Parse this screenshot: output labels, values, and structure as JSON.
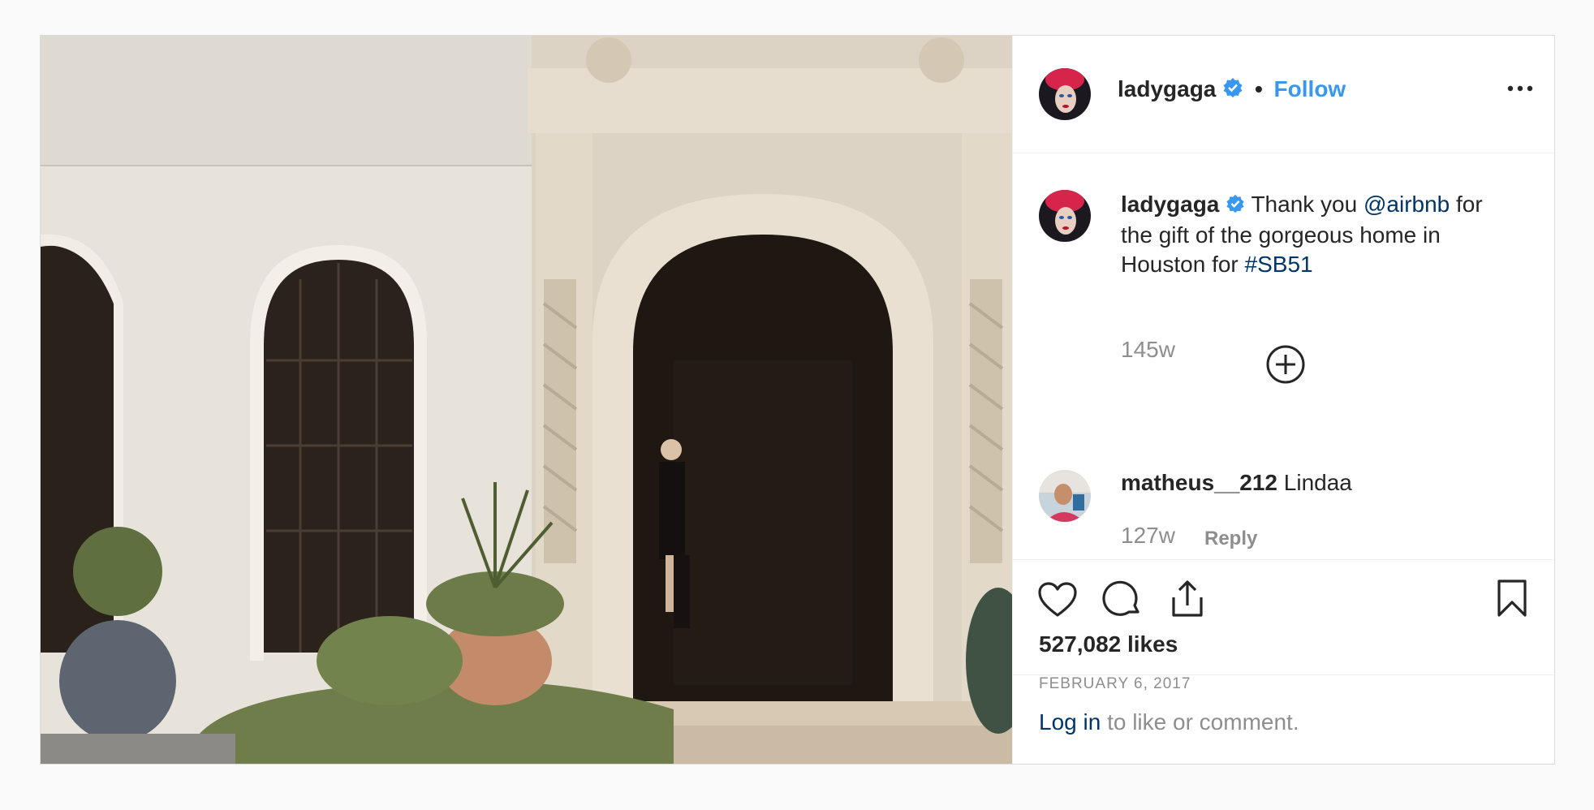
{
  "post": {
    "header": {
      "username": "ladygaga",
      "separator": "•",
      "follow_label": "Follow",
      "more_icon": "more-options-icon"
    },
    "caption": {
      "username": "ladygaga",
      "text_before": "Thank you ",
      "mention": "@airbnb",
      "text_middle": " for the gift of the gorgeous home in Houston for ",
      "hashtag": "#SB51",
      "time": "145w"
    },
    "load_more_icon": "plus-circle-icon",
    "comments": [
      {
        "username": "matheus__212",
        "text": "Lindaa",
        "time": "127w",
        "reply_label": "Reply"
      }
    ],
    "actions": {
      "icons": [
        "heart-icon",
        "comment-icon",
        "share-icon",
        "bookmark-icon"
      ]
    },
    "likes": "527,082 likes",
    "date": "FEBRUARY 6, 2017",
    "login": {
      "link": "Log in",
      "text": " to like or comment."
    }
  },
  "colors": {
    "accent": "#3897f0",
    "link": "#003569",
    "muted": "#8e8e8e",
    "text": "#262626",
    "border": "#dbdbdb"
  }
}
